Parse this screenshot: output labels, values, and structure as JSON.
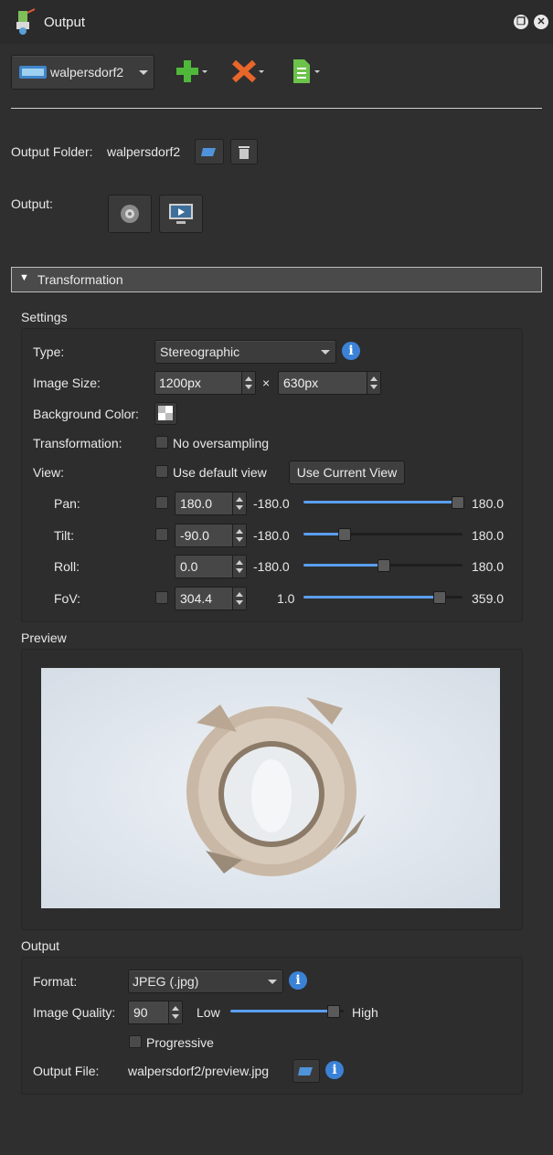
{
  "window": {
    "title": "Output",
    "float_icon": "restore-icon",
    "close_icon": "close-icon"
  },
  "toolbar": {
    "project": "walpersdorf2",
    "add_icon": "green-plus-icon",
    "remove_icon": "orange-x-icon",
    "doc_icon": "green-document-icon"
  },
  "output_folder": {
    "label": "Output Folder:",
    "value": "walpersdorf2"
  },
  "output_row": {
    "label": "Output:"
  },
  "transformation_header": "Transformation",
  "settings": {
    "title": "Settings",
    "type_label": "Type:",
    "type_value": "Stereographic",
    "image_size_label": "Image Size:",
    "width": "1200px",
    "times": "×",
    "height": "630px",
    "bg_label": "Background Color:",
    "transformation_label": "Transformation:",
    "no_oversampling": "No oversampling",
    "view_label": "View:",
    "use_default_view": "Use default view",
    "use_current_view": "Use Current View",
    "pan": {
      "label": "Pan:",
      "value": "180.0",
      "min": "-180.0",
      "max": "180.0",
      "level": 1.0
    },
    "tilt": {
      "label": "Tilt:",
      "value": "-90.0",
      "min": "-180.0",
      "max": "180.0",
      "level": 0.25
    },
    "roll": {
      "label": "Roll:",
      "value": "0.0",
      "min": "-180.0",
      "max": "180.0",
      "level": 0.5
    },
    "fov": {
      "label": "FoV:",
      "value": "304.4",
      "min": "1.0",
      "max": "359.0",
      "level": 0.85
    }
  },
  "preview": {
    "title": "Preview"
  },
  "output": {
    "title": "Output",
    "format_label": "Format:",
    "format_value": "JPEG (.jpg)",
    "quality_label": "Image Quality:",
    "quality_value": "90",
    "low": "Low",
    "high": "High",
    "quality_level": 0.9,
    "progressive": "Progressive",
    "file_label": "Output File:",
    "file_value": "walpersdorf2/preview.jpg"
  },
  "colors": {
    "accent": "#5b9ff0",
    "info": "#3b82d6"
  }
}
